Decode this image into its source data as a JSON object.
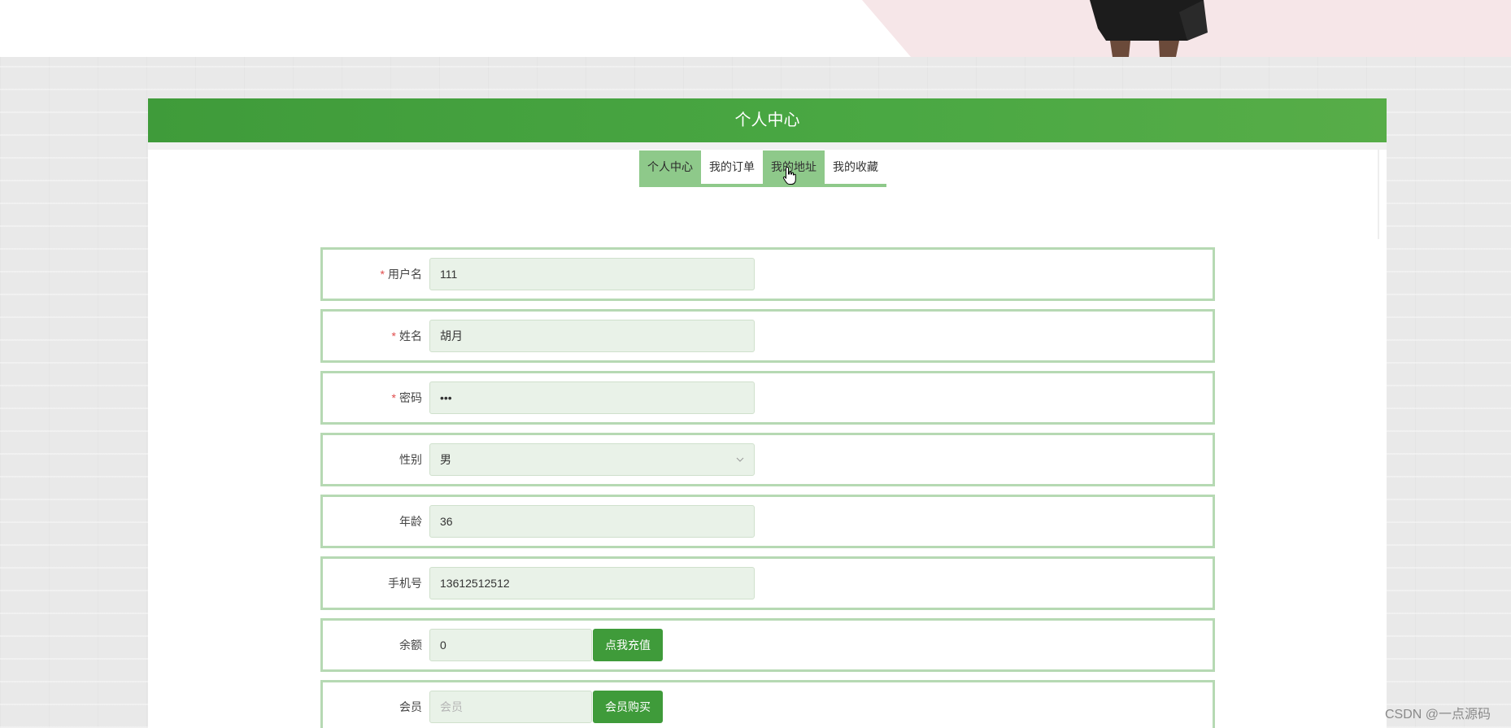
{
  "header": {
    "title": "个人中心"
  },
  "tabs": [
    {
      "label": "个人中心",
      "active": true
    },
    {
      "label": "我的订单",
      "active": false
    },
    {
      "label": "我的地址",
      "active": false
    },
    {
      "label": "我的收藏",
      "active": false
    }
  ],
  "form": {
    "username": {
      "label": "用户名",
      "required": true,
      "value": "111"
    },
    "name": {
      "label": "姓名",
      "required": true,
      "value": "胡月"
    },
    "password": {
      "label": "密码",
      "required": true,
      "value": "•••"
    },
    "gender": {
      "label": "性别",
      "value": "男"
    },
    "age": {
      "label": "年龄",
      "value": "36"
    },
    "phone": {
      "label": "手机号",
      "value": "13612512512"
    },
    "balance": {
      "label": "余额",
      "value": "0",
      "button": "点我充值"
    },
    "member": {
      "label": "会员",
      "placeholder": "会员",
      "button": "会员购买"
    }
  },
  "required_mark": "*",
  "watermark": "CSDN @一点源码",
  "colors": {
    "primary_green": "#3f9b3a",
    "tab_green": "#8ec98a",
    "field_bg": "#e9f2e8",
    "row_border": "#b6d9b3",
    "required_red": "#e04b4b"
  }
}
